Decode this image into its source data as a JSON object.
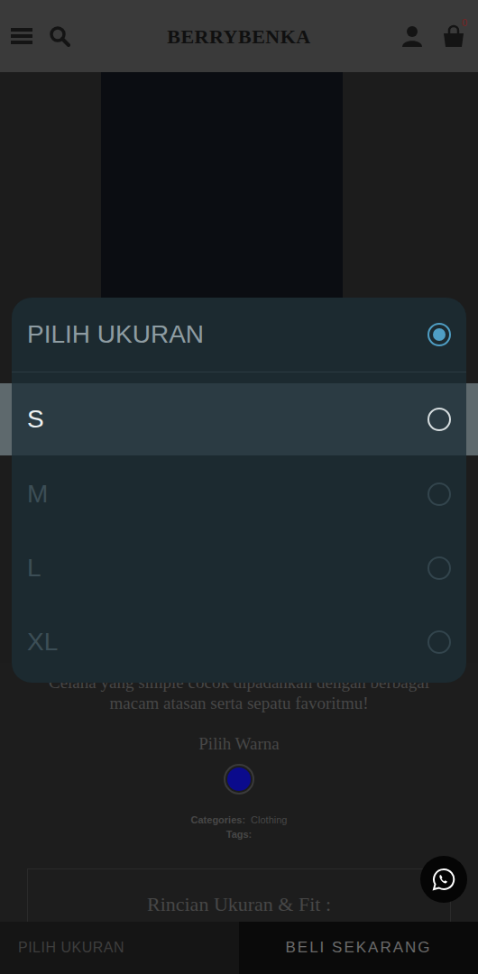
{
  "header": {
    "logo": "BERRYBENKA",
    "cart_count": "0"
  },
  "product": {
    "description": "Celana yang simple cocok dipadankan dengan berbagai macam atasan serta sepatu favoritmu!",
    "color_label": "Pilih Warna",
    "colors": [
      {
        "selected": true,
        "color": "#0b0b8c"
      }
    ],
    "categories_label": "Categories:",
    "categories": "Clothing",
    "tags_label": "Tags:",
    "size_details_title": "Rincian Ukuran & Fit :"
  },
  "size_dialog": {
    "options": [
      {
        "kind": "placeholder",
        "label": "PILIH UKURAN",
        "selected": true,
        "highlighted": false,
        "disabled": false
      },
      {
        "kind": "option",
        "label": "S",
        "selected": false,
        "highlighted": true,
        "disabled": false
      },
      {
        "kind": "option",
        "label": "M",
        "selected": false,
        "highlighted": false,
        "disabled": true
      },
      {
        "kind": "option",
        "label": "L",
        "selected": false,
        "highlighted": false,
        "disabled": true
      },
      {
        "kind": "option",
        "label": "XL",
        "selected": false,
        "highlighted": false,
        "disabled": true
      }
    ]
  },
  "bottom_bar": {
    "size_button": "PILIH UKURAN",
    "buy_button": "BELI SEKARANG"
  }
}
